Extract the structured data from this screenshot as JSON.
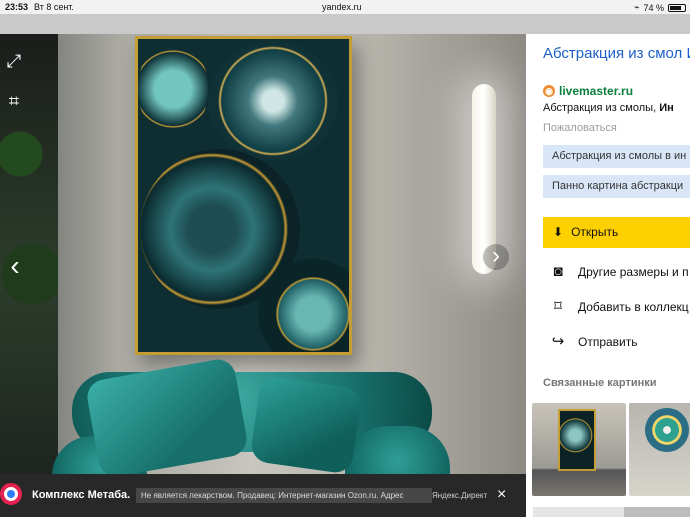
{
  "status_bar": {
    "time": "23:53",
    "date": "Вт 8 сент.",
    "url": "yandex.ru",
    "battery": "74 %",
    "wifi_icon": "wifi-icon",
    "lock_icon": "lock-icon"
  },
  "viewer": {
    "fullscreen_icon": "fullscreen-icon",
    "crop_icon": "crop-icon",
    "prev_icon": "chevron-left-icon",
    "next_icon": "chevron-right-icon",
    "prev_label": "‹",
    "next_label": "›"
  },
  "side_panel": {
    "title": "Абстракция из смол Интерьерная картин",
    "source": "livemaster.ru",
    "description_prefix": "Абстракция из смолы, ",
    "description_bold": "Ин",
    "complain": "Пожаловаться",
    "tags": [
      "Абстракция из смолы в ин",
      "Панно картина абстракци"
    ],
    "open_button": "Открыть",
    "actions": [
      "Другие размеры и п",
      "Добавить в коллекц",
      "Отправить"
    ],
    "related_title": "Связанные картинки"
  },
  "ad": {
    "title": "Комплекс Метаба.",
    "text": "Не является лекарством. Продавец: Интернет-магазин Ozon.ru. Адрес",
    "label": "Яндекс.Директ",
    "close": "×"
  },
  "colors": {
    "link": "#1e5fc9",
    "source_green": "#0a7f3d",
    "yellow_button": "#ffd000",
    "tag_background": "#d9e6f7"
  }
}
